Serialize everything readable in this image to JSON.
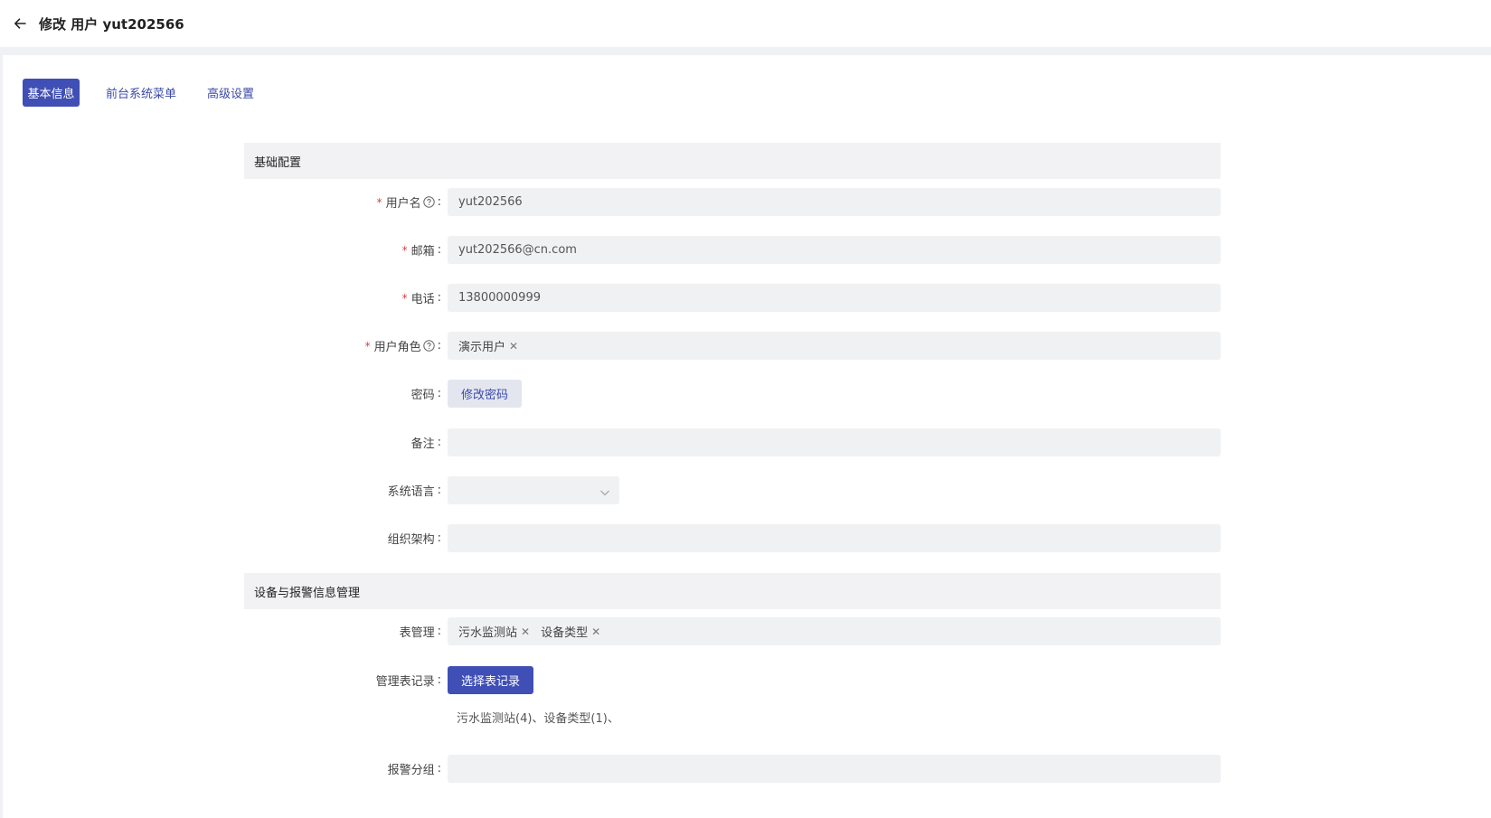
{
  "header": {
    "title": "修改 用户 yut202566"
  },
  "tabs": [
    {
      "label": "基本信息",
      "active": true
    },
    {
      "label": "前台系统菜单",
      "active": false
    },
    {
      "label": "高级设置",
      "active": false
    }
  ],
  "sections": {
    "basic": {
      "title": "基础配置"
    },
    "device": {
      "title": "设备与报警信息管理"
    }
  },
  "fields": {
    "username": {
      "label": "用户名",
      "value": "yut202566",
      "required": true
    },
    "email": {
      "label": "邮箱",
      "value": "yut202566@cn.com",
      "required": true
    },
    "phone": {
      "label": "电话",
      "value": "13800000999",
      "required": true
    },
    "roles": {
      "label": "用户角色",
      "required": true,
      "tags": [
        "演示用户"
      ]
    },
    "password": {
      "label": "密码",
      "button": "修改密码"
    },
    "remark": {
      "label": "备注",
      "value": ""
    },
    "language": {
      "label": "系统语言",
      "value": ""
    },
    "org": {
      "label": "组织架构",
      "value": ""
    },
    "tables": {
      "label": "表管理",
      "tags": [
        "污水监测站",
        "设备类型"
      ]
    },
    "records": {
      "label": "管理表记录",
      "button": "选择表记录",
      "summary": "污水监测站(4)、设备类型(1)、"
    },
    "alarm_group": {
      "label": "报警分组",
      "value": ""
    }
  },
  "colors": {
    "primary": "#3f4fb5",
    "required": "#e03e3e",
    "field_bg": "#f0f1f3"
  }
}
